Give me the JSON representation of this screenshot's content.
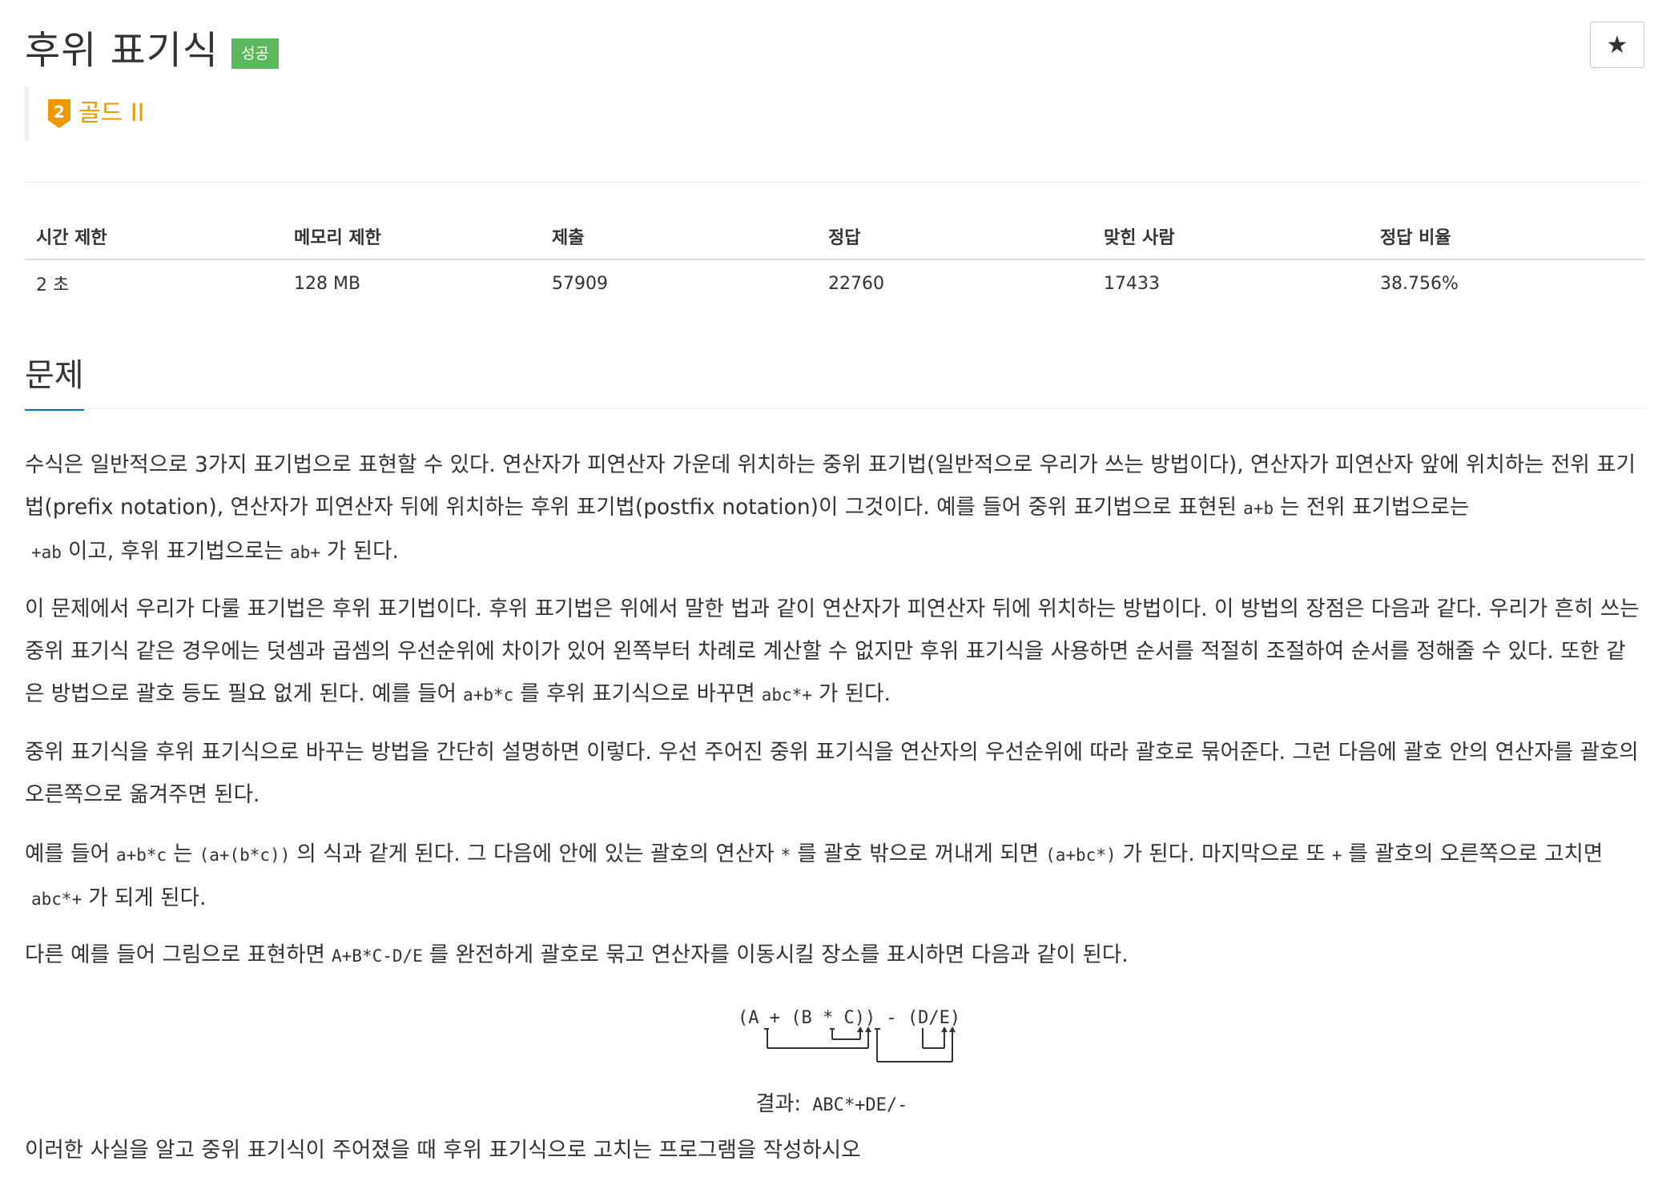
{
  "header": {
    "title": "후위 표기식",
    "status_badge": "성공",
    "star_glyph": "★"
  },
  "tier": {
    "level": "2",
    "label": "골드 II",
    "color": "#ec9a00"
  },
  "info_table": {
    "headers": [
      "시간 제한",
      "메모리 제한",
      "제출",
      "정답",
      "맞힌 사람",
      "정답 비율"
    ],
    "values": [
      "2 초",
      "128 MB",
      "57909",
      "22760",
      "17433",
      "38.756%"
    ]
  },
  "problem": {
    "section_title": "문제",
    "p1": {
      "t1": "수식은 일반적으로 3가지 표기법으로 표현할 수 있다. 연산자가 피연산자 가운데 위치하는 중위 표기법(일반적으로 우리가 쓰는 방법이다), 연산자가 피연산자 앞에 위치하는 전위 표기법(prefix notation), 연산자가 피연산자 뒤에 위치하는 후위 표기법(postfix notation)이 그것이다. 예를 들어 중위 표기법으로 표현된",
      "c1": "a+b",
      "t2": "는 전위 표기법으로는",
      "c2": "+ab",
      "t3": "이고, 후위 표기법으로는",
      "c3": "ab+",
      "t4": "가 된다."
    },
    "p2": {
      "t1": "이 문제에서 우리가 다룰 표기법은 후위 표기법이다. 후위 표기법은 위에서 말한 법과 같이 연산자가 피연산자 뒤에 위치하는 방법이다. 이 방법의 장점은 다음과 같다. 우리가 흔히 쓰는 중위 표기식 같은 경우에는 덧셈과 곱셈의 우선순위에 차이가 있어 왼쪽부터 차례로 계산할 수 없지만 후위 표기식을 사용하면 순서를 적절히 조절하여 순서를 정해줄 수 있다. 또한 같은 방법으로 괄호 등도 필요 없게 된다. 예를 들어",
      "c1": "a+b*c",
      "t2": "를 후위 표기식으로 바꾸면",
      "c2": "abc*+",
      "t3": "가 된다."
    },
    "p3": {
      "t1": "중위 표기식을 후위 표기식으로 바꾸는 방법을 간단히 설명하면 이렇다. 우선 주어진 중위 표기식을 연산자의 우선순위에 따라 괄호로 묶어준다. 그런 다음에 괄호 안의 연산자를 괄호의 오른쪽으로 옮겨주면 된다."
    },
    "p4": {
      "t1": "예를 들어",
      "c1": "a+b*c",
      "t2": "는",
      "c2": "(a+(b*c))",
      "t3": "의 식과 같게 된다. 그 다음에 안에 있는 괄호의 연산자",
      "c3": "*",
      "t4": "를 괄호 밖으로 꺼내게 되면",
      "c4": "(a+bc*)",
      "t5": "가 된다. 마지막으로 또",
      "c5": "+",
      "t6": "를 괄호의 오른쪽으로 고치면",
      "c6": "abc*+",
      "t7": "가 되게 된다."
    },
    "p5": {
      "t1": "다른 예를 들어 그림으로 표현하면",
      "c1": "A+B*C-D/E",
      "t2": "를 완전하게 괄호로 묶고 연산자를 이동시킬 장소를 표시하면 다음과 같이 된다."
    },
    "figure": {
      "expression": "(A + (B * C)) - (D/E)"
    },
    "result": {
      "label": "결과:",
      "value": "ABC*+DE/-"
    },
    "p6": {
      "t1": "이러한 사실을 알고 중위 표기식이 주어졌을 때 후위 표기식으로 고치는 프로그램을 작성하시오"
    }
  }
}
